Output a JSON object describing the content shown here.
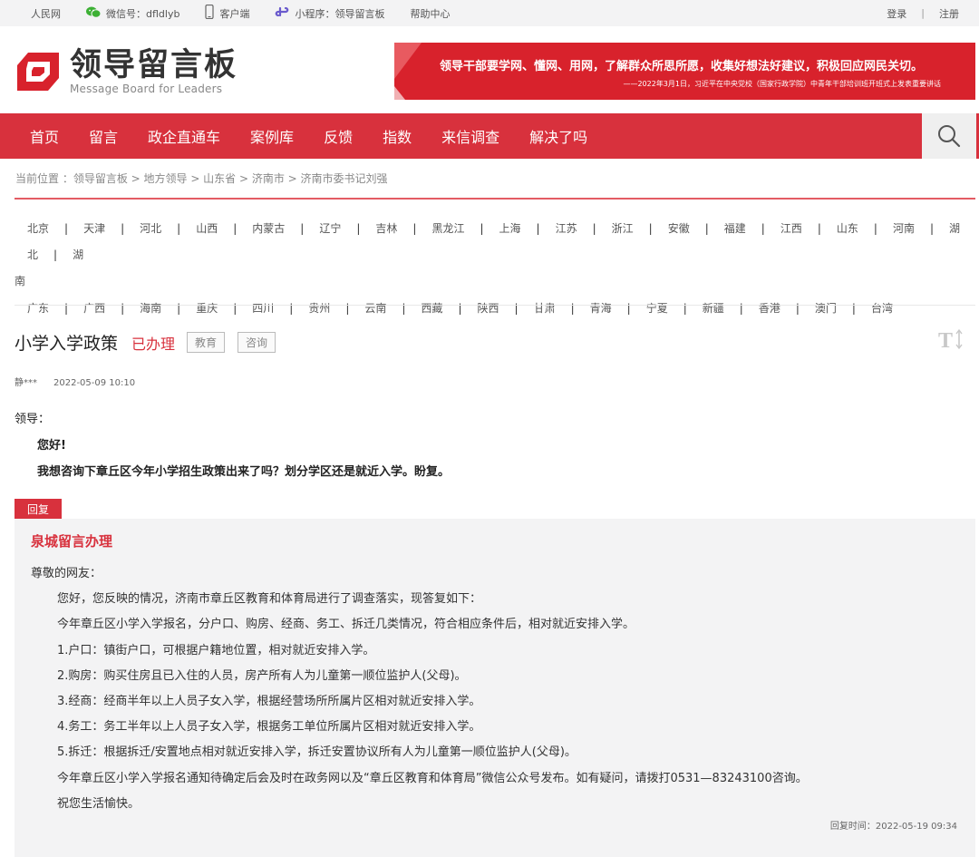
{
  "topbar": {
    "site": "人民网",
    "wechat": "微信号：dfldlyb",
    "app": "客户端",
    "mini": "小程序：领导留言板",
    "help": "帮助中心",
    "login": "登录",
    "sep": "|",
    "register": "注册"
  },
  "header": {
    "title": "领导留言板",
    "subtitle": "Message Board for Leaders",
    "banner_main": "领导干部要学网、懂网、用网，了解群众所思所愿，收集好想法好建议，积极回应网民关切。",
    "banner_sub": "——2022年3月1日，习近平在中央党校（国家行政学院）中青年干部培训班开班式上发表重要讲话"
  },
  "nav": {
    "items": [
      "首页",
      "留言",
      "政企直通车",
      "案例库",
      "反馈",
      "指数",
      "来信调查",
      "解决了吗"
    ]
  },
  "breadcrumb": "当前位置 ：领导留言板 > 地方领导 > 山东省 > 济南市 > 济南市委书记刘强",
  "regions": {
    "row1": [
      "北京",
      "天津",
      "河北",
      "山西",
      "内蒙古",
      "辽宁",
      "吉林",
      "黑龙江",
      "上海",
      "江苏",
      "浙江",
      "安徽",
      "福建",
      "江西",
      "山东",
      "河南",
      "湖北"
    ],
    "row1_last": "湖",
    "row1_wrap": "南",
    "row2": [
      "广东",
      "广西",
      "海南",
      "重庆",
      "四川",
      "贵州",
      "云南",
      "西藏",
      "陕西",
      "甘肃",
      "青海",
      "宁夏",
      "新疆",
      "香港",
      "澳门",
      "台湾"
    ]
  },
  "question": {
    "title": "小学入学政策",
    "status": "已办理",
    "tags": [
      "教育",
      "咨询"
    ],
    "author": "静***",
    "date": "2022-05-09 10:10",
    "salutation": "领导：",
    "greeting": "您好!",
    "content": "我想咨询下章丘区今年小学招生政策出来了吗？划分学区还是就近入学。盼复。"
  },
  "reply": {
    "label": "回复",
    "replier": "泉城留言办理",
    "salutation": "尊敬的网友：",
    "paragraphs": [
      "您好，您反映的情况，济南市章丘区教育和体育局进行了调查落实，现答复如下：",
      "今年章丘区小学入学报名，分户口、购房、经商、务工、拆迁几类情况，符合相应条件后，相对就近安排入学。",
      "1.户口：镇街户口，可根据户籍地位置，相对就近安排入学。",
      "2.购房：购买住房且已入住的人员，房产所有人为儿童第一顺位监护人(父母)。",
      "3.经商：经商半年以上人员子女入学，根据经营场所所属片区相对就近安排入学。",
      "4.务工：务工半年以上人员子女入学，根据务工单位所属片区相对就近安排入学。",
      "5.拆迁：根据拆迁/安置地点相对就近安排入学，拆迁安置协议所有人为儿童第一顺位监护人(父母)。",
      "今年章丘区小学入学报名通知待确定后会及时在政务网以及“章丘区教育和体育局”微信公众号发布。如有疑问，请拨打0531—83243100咨询。",
      "祝您生活愉快。"
    ],
    "time": "回复时间：2022-05-19 09:34"
  },
  "colors": {
    "accent": "#d8313d",
    "banner": "#d8222c"
  },
  "icons": [
    "wechat-icon",
    "phone-icon",
    "miniprogram-icon",
    "search-icon",
    "font-size-icon",
    "logo-mark-icon"
  ]
}
